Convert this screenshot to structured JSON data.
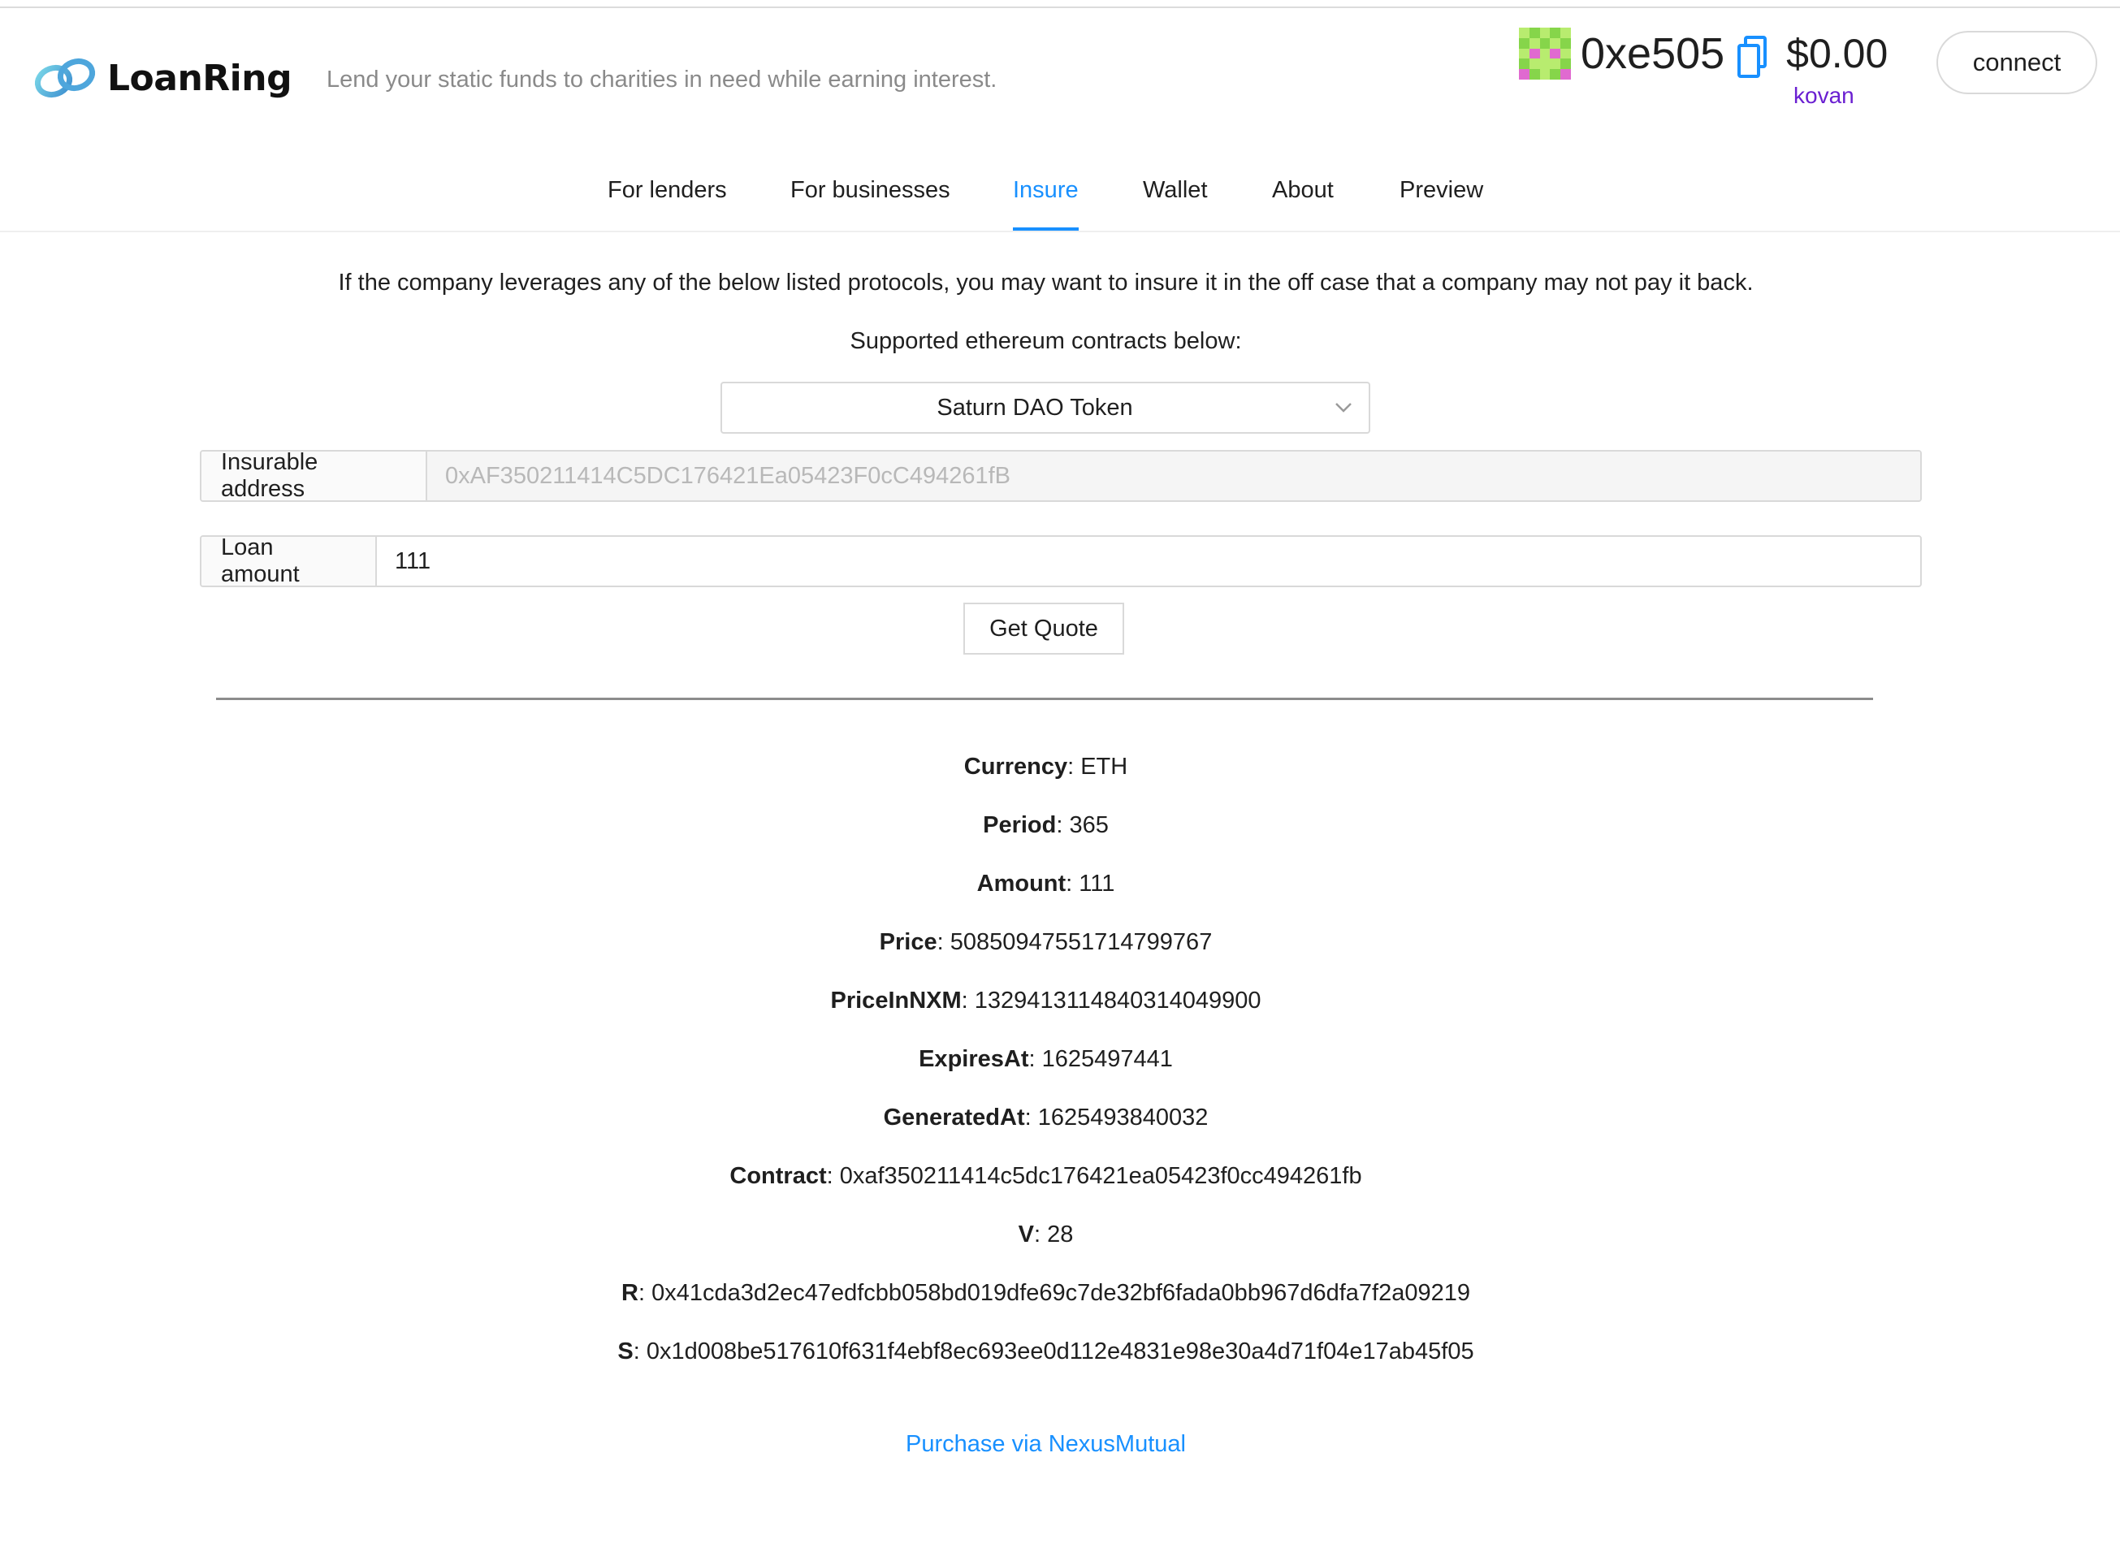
{
  "brand": {
    "name": "LoanRing",
    "tagline": "Lend your static funds to charities in need while earning interest."
  },
  "account": {
    "address": "0xe505",
    "balance": "$0.00",
    "network": "kovan",
    "connect_label": "connect"
  },
  "nav": {
    "tabs": [
      "For lenders",
      "For businesses",
      "Insure",
      "Wallet",
      "About",
      "Preview"
    ],
    "active": "Insure"
  },
  "insure": {
    "intro": "If the company leverages any of the below listed protocols, you may want to insure it in the off case that a company may not pay it back.",
    "supported_label": "Supported ethereum contracts below:",
    "selected_contract": "Saturn DAO Token",
    "insurable_address_label": "Insurable address",
    "insurable_address_value": "0xAF350211414C5DC176421Ea05423F0cC494261fB",
    "loan_amount_label": "Loan amount",
    "loan_amount_value": "111",
    "get_quote_label": "Get Quote"
  },
  "quote": [
    {
      "key": "Currency",
      "value": "ETH"
    },
    {
      "key": "Period",
      "value": "365"
    },
    {
      "key": "Amount",
      "value": "111"
    },
    {
      "key": "Price",
      "value": "50850947551714799767"
    },
    {
      "key": "PriceInNXM",
      "value": "1329413114840314049900"
    },
    {
      "key": "ExpiresAt",
      "value": "1625497441"
    },
    {
      "key": "GeneratedAt",
      "value": "1625493840032"
    },
    {
      "key": "Contract",
      "value": "0xaf350211414c5dc176421ea05423f0cc494261fb"
    },
    {
      "key": "V",
      "value": "28"
    },
    {
      "key": "R",
      "value": "0x41cda3d2ec47edfcbb058bd019dfe69c7de32bf6fada0bb967d6dfa7f2a09219"
    },
    {
      "key": "S",
      "value": "0x1d008be517610f631f4ebf8ec693ee0d112e4831e98e30a4d71f04e17ab45f05"
    }
  ],
  "purchase_label": "Purchase via NexusMutual",
  "colors": {
    "accent": "#1890ff",
    "network": "#6a1fd1",
    "identicon_light": "#b8ec6f",
    "identicon_mid": "#86d54a",
    "identicon_pink": "#e06ad0"
  },
  "icons": {
    "logo": "loanring-rings-logo",
    "copy": "copy-icon",
    "select_arrow": "chevron-down-icon",
    "avatar": "identicon-avatar"
  }
}
